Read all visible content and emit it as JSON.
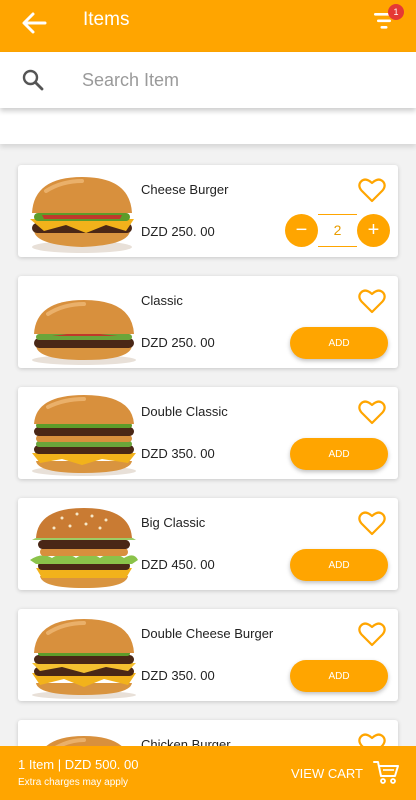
{
  "header": {
    "title": "Items",
    "cart_badge": "1"
  },
  "search": {
    "placeholder": "Search Item",
    "value": ""
  },
  "items": [
    {
      "name": "Cheese Burger",
      "price": "DZD 250. 00",
      "action": "stepper",
      "quantity": "2",
      "minus": "−",
      "plus": "+"
    },
    {
      "name": "Classic",
      "price": "DZD 250. 00",
      "action": "add",
      "add_label": "ADD"
    },
    {
      "name": "Double Classic",
      "price": "DZD 350. 00",
      "action": "add",
      "add_label": "ADD"
    },
    {
      "name": "Big Classic",
      "price": "DZD 450. 00",
      "action": "add",
      "add_label": "ADD"
    },
    {
      "name": "Double Cheese Burger",
      "price": "DZD 350. 00",
      "action": "add",
      "add_label": "ADD"
    },
    {
      "name": "Chicken Burger"
    }
  ],
  "cart_bar": {
    "summary": "1 Item | DZD 500. 00",
    "note": "Extra charges may apply",
    "view_label": "VIEW CART"
  },
  "colors": {
    "accent": "#ffa500",
    "badge": "#e53935"
  },
  "icons": {
    "back": "arrow-left-icon",
    "filter": "filter-icon",
    "search": "search-icon",
    "favorite": "heart-outline-icon",
    "cart": "shopping-cart-icon"
  }
}
